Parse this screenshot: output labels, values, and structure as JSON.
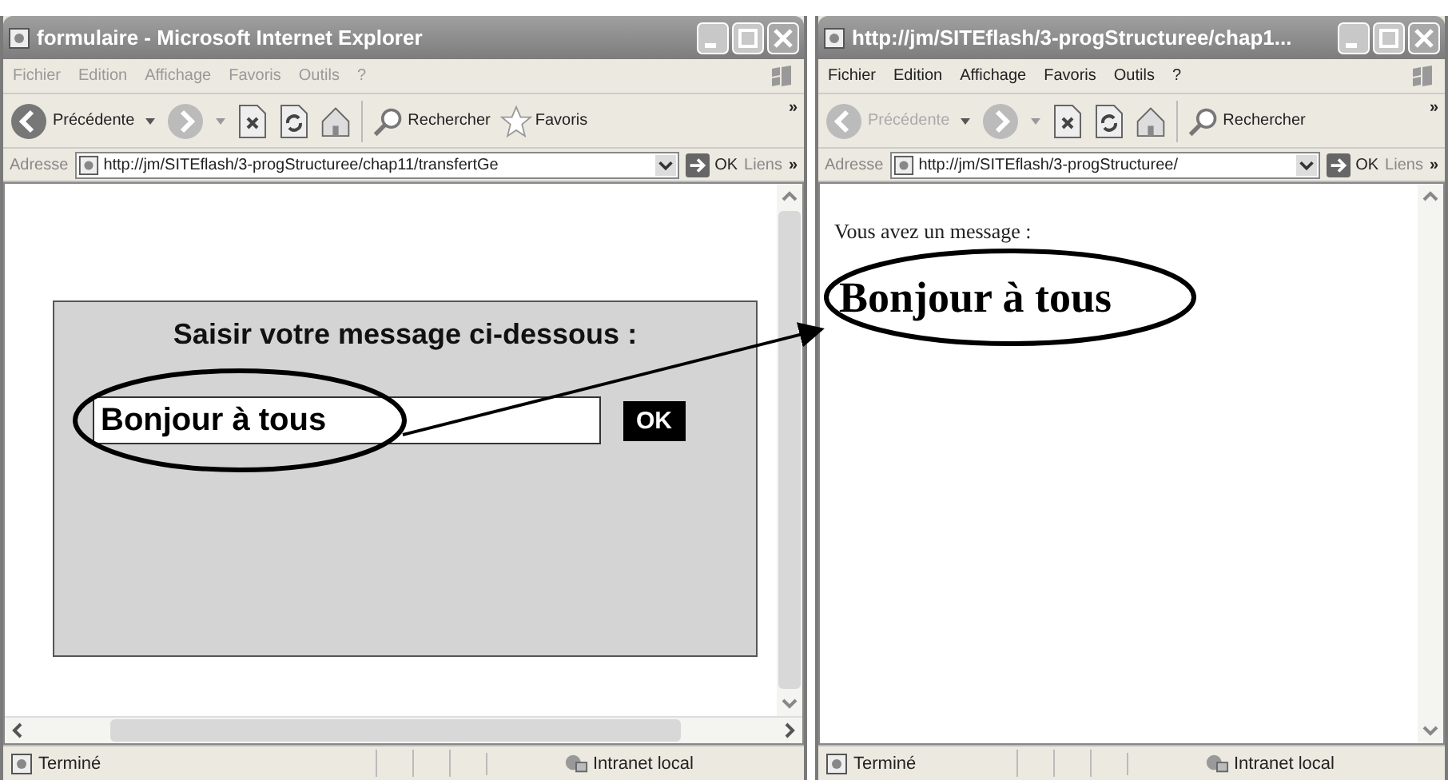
{
  "windows": [
    {
      "title": "formulaire - Microsoft Internet Explorer",
      "active": false,
      "menu": [
        "Fichier",
        "Edition",
        "Affichage",
        "Favoris",
        "Outils",
        "?"
      ],
      "back": {
        "label": "Précédente",
        "disabled": false
      },
      "search": "Rechercher",
      "favorites": "Favoris",
      "more": "»",
      "address": {
        "label": "Adresse",
        "url": "http://jm/SITEflash/3-progStructuree/chap11/transfertGe",
        "go": "OK",
        "links": "Liens",
        "more": "»"
      },
      "content": {
        "kind": "form",
        "heading": "Saisir votre message ci-dessous :",
        "value": "Bonjour à tous",
        "button": "OK"
      },
      "status": {
        "text": "Terminé",
        "zone": "Intranet local"
      }
    },
    {
      "title": "http://jm/SITEflash/3-progStructuree/chap1...",
      "active": true,
      "menu": [
        "Fichier",
        "Edition",
        "Affichage",
        "Favoris",
        "Outils",
        "?"
      ],
      "back": {
        "label": "Précédente",
        "disabled": true
      },
      "search": "Rechercher",
      "more": "»",
      "address": {
        "label": "Adresse",
        "url": "http://jm/SITEflash/3-progStructuree/",
        "go": "OK",
        "links": "Liens",
        "more": "»"
      },
      "content": {
        "kind": "message",
        "intro": "Vous avez un message :",
        "message": "Bonjour à tous"
      },
      "status": {
        "text": "Terminé",
        "zone": "Intranet local"
      }
    }
  ]
}
